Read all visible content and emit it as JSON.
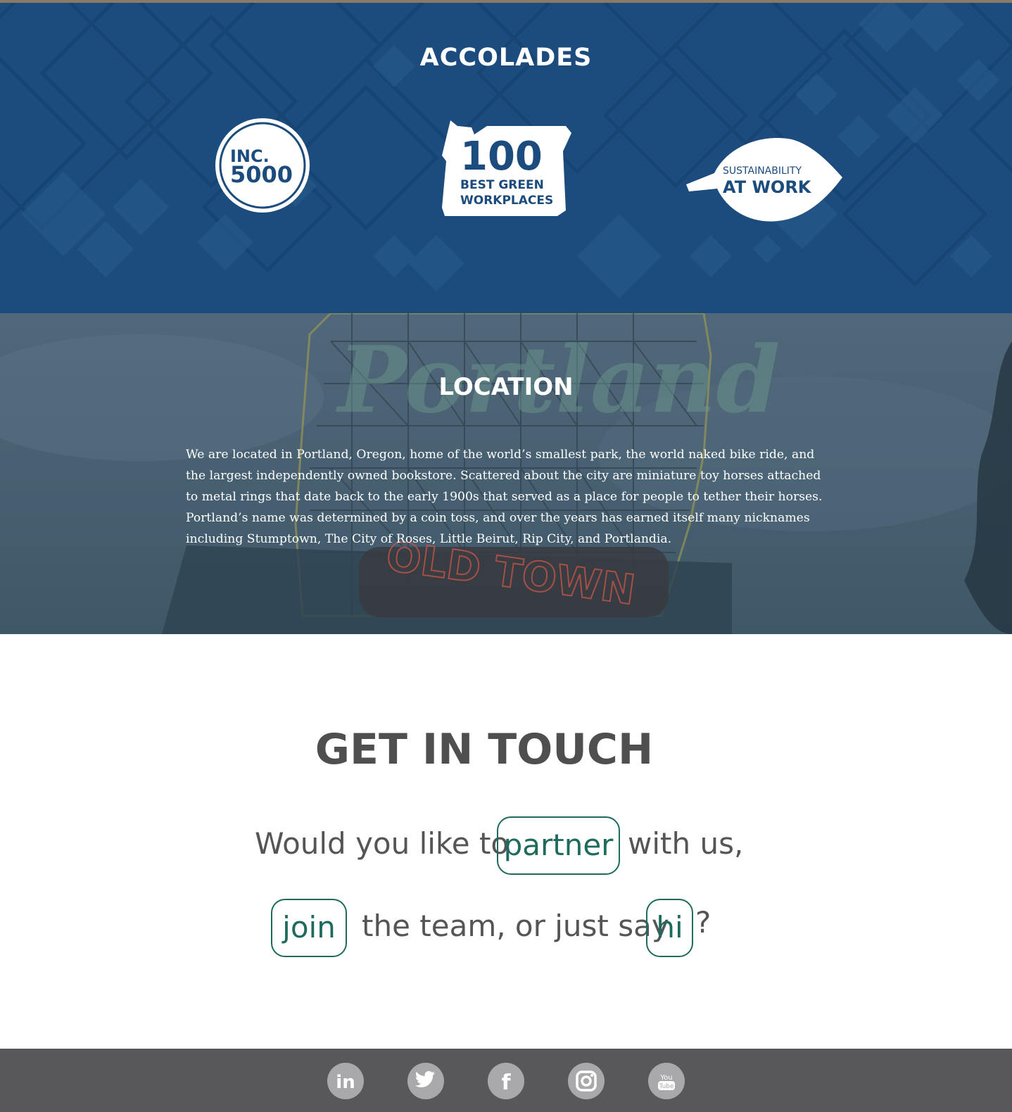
{
  "accolades": {
    "title": "ACCOLADES",
    "awards": [
      {
        "line1": "INC.",
        "line2": "5000"
      },
      {
        "line1": "100",
        "line2": "BEST GREEN",
        "line3": "WORKPLACES"
      },
      {
        "line1": "SUSTAINABILITY",
        "line2": "AT WORK"
      }
    ]
  },
  "location": {
    "title": "LOCATION",
    "body": "We are located in Portland, Oregon, home of the world’s smallest park, the world naked bike ride, and the largest independently owned bookstore. Scattered about the city are miniature toy horses attached to metal rings that date back to the early 1900s that served as a place for people to tether their horses. Portland’s name was determined by a coin toss, and over the years has earned itself many nicknames including Stumptown, The City of Roses, Little Beirut, Rip City, and Portlandia.",
    "sign_text": "Portland",
    "sign_subtext": "OLD TOWN"
  },
  "contact": {
    "title": "GET IN TOUCH",
    "line1_before": "Would you like to",
    "partner_label": "partner",
    "line1_after": "with us,",
    "join_label": "join",
    "line2_middle": "the team, or just say",
    "hi_label": "hi",
    "line2_end": "?"
  },
  "footer": {
    "social": [
      {
        "name": "linkedin",
        "icon": "linkedin-icon",
        "glyph": "in"
      },
      {
        "name": "twitter",
        "icon": "twitter-icon"
      },
      {
        "name": "facebook",
        "icon": "facebook-icon",
        "glyph": "f"
      },
      {
        "name": "instagram",
        "icon": "instagram-icon"
      },
      {
        "name": "youtube",
        "icon": "youtube-icon",
        "glyph_top": "You",
        "glyph_bottom": "Tube"
      }
    ]
  },
  "colors": {
    "accolades_bg": "#1b4c7d",
    "accent_teal": "#1e6b5e",
    "footer_bg": "#58585a",
    "social_icon_bg": "#a9a9ab"
  }
}
